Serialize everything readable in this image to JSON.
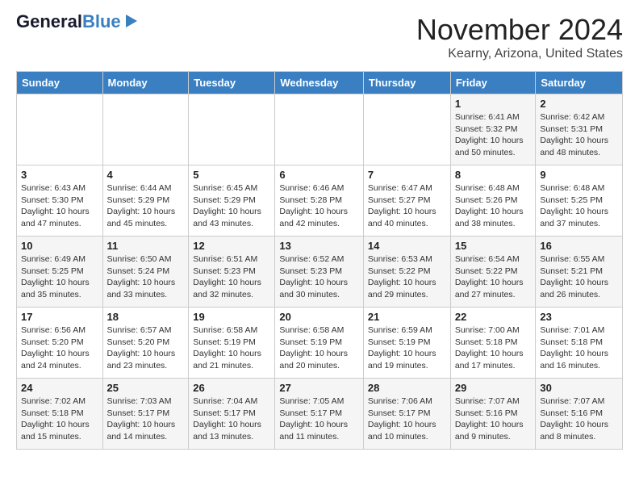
{
  "header": {
    "logo_general": "General",
    "logo_blue": "Blue",
    "month": "November 2024",
    "location": "Kearny, Arizona, United States"
  },
  "weekdays": [
    "Sunday",
    "Monday",
    "Tuesday",
    "Wednesday",
    "Thursday",
    "Friday",
    "Saturday"
  ],
  "weeks": [
    [
      {
        "day": "",
        "info": ""
      },
      {
        "day": "",
        "info": ""
      },
      {
        "day": "",
        "info": ""
      },
      {
        "day": "",
        "info": ""
      },
      {
        "day": "",
        "info": ""
      },
      {
        "day": "1",
        "info": "Sunrise: 6:41 AM\nSunset: 5:32 PM\nDaylight: 10 hours\nand 50 minutes."
      },
      {
        "day": "2",
        "info": "Sunrise: 6:42 AM\nSunset: 5:31 PM\nDaylight: 10 hours\nand 48 minutes."
      }
    ],
    [
      {
        "day": "3",
        "info": "Sunrise: 6:43 AM\nSunset: 5:30 PM\nDaylight: 10 hours\nand 47 minutes."
      },
      {
        "day": "4",
        "info": "Sunrise: 6:44 AM\nSunset: 5:29 PM\nDaylight: 10 hours\nand 45 minutes."
      },
      {
        "day": "5",
        "info": "Sunrise: 6:45 AM\nSunset: 5:29 PM\nDaylight: 10 hours\nand 43 minutes."
      },
      {
        "day": "6",
        "info": "Sunrise: 6:46 AM\nSunset: 5:28 PM\nDaylight: 10 hours\nand 42 minutes."
      },
      {
        "day": "7",
        "info": "Sunrise: 6:47 AM\nSunset: 5:27 PM\nDaylight: 10 hours\nand 40 minutes."
      },
      {
        "day": "8",
        "info": "Sunrise: 6:48 AM\nSunset: 5:26 PM\nDaylight: 10 hours\nand 38 minutes."
      },
      {
        "day": "9",
        "info": "Sunrise: 6:48 AM\nSunset: 5:25 PM\nDaylight: 10 hours\nand 37 minutes."
      }
    ],
    [
      {
        "day": "10",
        "info": "Sunrise: 6:49 AM\nSunset: 5:25 PM\nDaylight: 10 hours\nand 35 minutes."
      },
      {
        "day": "11",
        "info": "Sunrise: 6:50 AM\nSunset: 5:24 PM\nDaylight: 10 hours\nand 33 minutes."
      },
      {
        "day": "12",
        "info": "Sunrise: 6:51 AM\nSunset: 5:23 PM\nDaylight: 10 hours\nand 32 minutes."
      },
      {
        "day": "13",
        "info": "Sunrise: 6:52 AM\nSunset: 5:23 PM\nDaylight: 10 hours\nand 30 minutes."
      },
      {
        "day": "14",
        "info": "Sunrise: 6:53 AM\nSunset: 5:22 PM\nDaylight: 10 hours\nand 29 minutes."
      },
      {
        "day": "15",
        "info": "Sunrise: 6:54 AM\nSunset: 5:22 PM\nDaylight: 10 hours\nand 27 minutes."
      },
      {
        "day": "16",
        "info": "Sunrise: 6:55 AM\nSunset: 5:21 PM\nDaylight: 10 hours\nand 26 minutes."
      }
    ],
    [
      {
        "day": "17",
        "info": "Sunrise: 6:56 AM\nSunset: 5:20 PM\nDaylight: 10 hours\nand 24 minutes."
      },
      {
        "day": "18",
        "info": "Sunrise: 6:57 AM\nSunset: 5:20 PM\nDaylight: 10 hours\nand 23 minutes."
      },
      {
        "day": "19",
        "info": "Sunrise: 6:58 AM\nSunset: 5:19 PM\nDaylight: 10 hours\nand 21 minutes."
      },
      {
        "day": "20",
        "info": "Sunrise: 6:58 AM\nSunset: 5:19 PM\nDaylight: 10 hours\nand 20 minutes."
      },
      {
        "day": "21",
        "info": "Sunrise: 6:59 AM\nSunset: 5:19 PM\nDaylight: 10 hours\nand 19 minutes."
      },
      {
        "day": "22",
        "info": "Sunrise: 7:00 AM\nSunset: 5:18 PM\nDaylight: 10 hours\nand 17 minutes."
      },
      {
        "day": "23",
        "info": "Sunrise: 7:01 AM\nSunset: 5:18 PM\nDaylight: 10 hours\nand 16 minutes."
      }
    ],
    [
      {
        "day": "24",
        "info": "Sunrise: 7:02 AM\nSunset: 5:18 PM\nDaylight: 10 hours\nand 15 minutes."
      },
      {
        "day": "25",
        "info": "Sunrise: 7:03 AM\nSunset: 5:17 PM\nDaylight: 10 hours\nand 14 minutes."
      },
      {
        "day": "26",
        "info": "Sunrise: 7:04 AM\nSunset: 5:17 PM\nDaylight: 10 hours\nand 13 minutes."
      },
      {
        "day": "27",
        "info": "Sunrise: 7:05 AM\nSunset: 5:17 PM\nDaylight: 10 hours\nand 11 minutes."
      },
      {
        "day": "28",
        "info": "Sunrise: 7:06 AM\nSunset: 5:17 PM\nDaylight: 10 hours\nand 10 minutes."
      },
      {
        "day": "29",
        "info": "Sunrise: 7:07 AM\nSunset: 5:16 PM\nDaylight: 10 hours\nand 9 minutes."
      },
      {
        "day": "30",
        "info": "Sunrise: 7:07 AM\nSunset: 5:16 PM\nDaylight: 10 hours\nand 8 minutes."
      }
    ]
  ]
}
